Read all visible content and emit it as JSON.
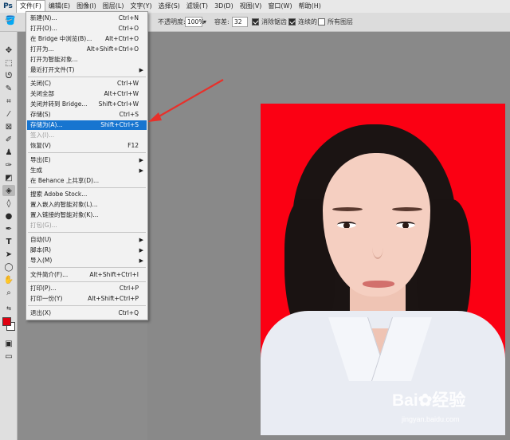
{
  "app": {
    "logo": "Ps"
  },
  "menubar": {
    "items": [
      "文件(F)",
      "编辑(E)",
      "图像(I)",
      "图层(L)",
      "文字(Y)",
      "选择(S)",
      "滤镜(T)",
      "3D(D)",
      "视图(V)",
      "窗口(W)",
      "帮助(H)"
    ],
    "active": "文件(F)"
  },
  "options": {
    "opacity_label": "不透明度:",
    "opacity_value": "100%",
    "tolerance_label": "容差:",
    "tolerance_value": "32",
    "antialias_label": "消除锯齿",
    "contiguous_label": "连续的",
    "all_layers_label": "所有图层"
  },
  "file_menu": {
    "new": {
      "label": "新建(N)...",
      "shortcut": "Ctrl+N"
    },
    "open": {
      "label": "打开(O)...",
      "shortcut": "Ctrl+O"
    },
    "bridge": {
      "label": "在 Bridge 中浏览(B)...",
      "shortcut": "Alt+Ctrl+O"
    },
    "open_as": {
      "label": "打开为...",
      "shortcut": "Alt+Shift+Ctrl+O"
    },
    "open_smart": {
      "label": "打开为智能对象..."
    },
    "recent": {
      "label": "最近打开文件(T)"
    },
    "close": {
      "label": "关闭(C)",
      "shortcut": "Ctrl+W"
    },
    "close_all": {
      "label": "关闭全部",
      "shortcut": "Alt+Ctrl+W"
    },
    "close_bridge": {
      "label": "关闭并转到 Bridge...",
      "shortcut": "Shift+Ctrl+W"
    },
    "save": {
      "label": "存储(S)",
      "shortcut": "Ctrl+S"
    },
    "save_as": {
      "label": "存储为(A)...",
      "shortcut": "Shift+Ctrl+S"
    },
    "checkin": {
      "label": "签入(I)..."
    },
    "revert": {
      "label": "恢复(V)",
      "shortcut": "F12"
    },
    "export": {
      "label": "导出(E)"
    },
    "generate": {
      "label": "生成"
    },
    "behance": {
      "label": "在 Behance 上共享(D)..."
    },
    "adobe_stock": {
      "label": "搜索 Adobe Stock..."
    },
    "place_embedded": {
      "label": "置入嵌入的智能对象(L)..."
    },
    "place_linked": {
      "label": "置入链接的智能对象(K)..."
    },
    "package": {
      "label": "打包(G)..."
    },
    "automate": {
      "label": "自动(U)"
    },
    "scripts": {
      "label": "脚本(R)"
    },
    "import": {
      "label": "导入(M)"
    },
    "file_info": {
      "label": "文件简介(F)...",
      "shortcut": "Alt+Shift+Ctrl+I"
    },
    "print": {
      "label": "打印(P)...",
      "shortcut": "Ctrl+P"
    },
    "print_one": {
      "label": "打印一份(Y)",
      "shortcut": "Alt+Shift+Ctrl+P"
    },
    "exit": {
      "label": "退出(X)",
      "shortcut": "Ctrl+Q"
    }
  },
  "watermark": {
    "brand": "Bai",
    "brand_cn": "经验",
    "url": "jingyan.baidu.com"
  },
  "colors": {
    "highlight": "#1775d0",
    "background_red": "#fb0013",
    "foreground_swatch": "#e00010"
  }
}
